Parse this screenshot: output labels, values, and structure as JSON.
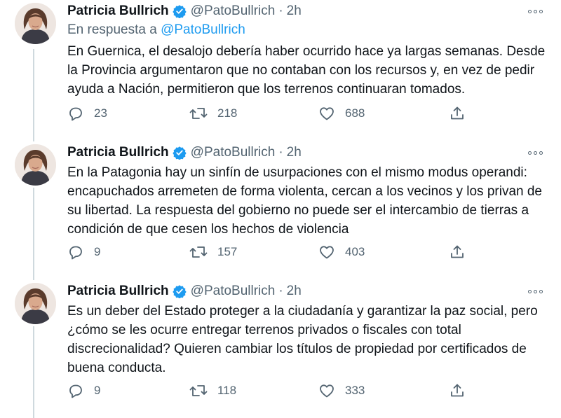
{
  "tweets": [
    {
      "author_name": "Patricia Bullrich",
      "handle": "@PatoBullrich",
      "separator": "·",
      "time": "2h",
      "reply_prefix": "En respuesta a",
      "reply_mention": "@PatoBullrich",
      "text": "En Guernica, el desalojo debería haber ocurrido hace ya largas semanas. Desde la Provincia argumentaron que no contaban con los recursos y, en vez de pedir ayuda a Nación, permitieron que los terrenos continuaran tomados.",
      "replies": "23",
      "retweets": "218",
      "likes": "688"
    },
    {
      "author_name": "Patricia Bullrich",
      "handle": "@PatoBullrich",
      "separator": "·",
      "time": "2h",
      "text": "En la Patagonia hay un sinfín de usurpaciones con el mismo modus operandi: encapuchados arremeten de forma violenta, cercan a los vecinos y los privan de su libertad. La respuesta del gobierno no puede ser el intercambio de tierras a condición de que cesen los hechos de violencia",
      "replies": "9",
      "retweets": "157",
      "likes": "403"
    },
    {
      "author_name": "Patricia Bullrich",
      "handle": "@PatoBullrich",
      "separator": "·",
      "time": "2h",
      "text": "Es un deber del Estado proteger a la ciudadanía y garantizar la paz social, pero ¿cómo se les ocurre entregar terrenos privados o fiscales con total discrecionalidad? Quieren cambiar los títulos de propiedad por certificados de buena conducta.",
      "replies": "9",
      "retweets": "118",
      "likes": "333"
    }
  ],
  "colors": {
    "accent": "#1d9bf0",
    "secondary_text": "#536471",
    "primary_text": "#0f1419",
    "thread_line": "#cfd9de"
  },
  "icons": [
    "verified-badge-icon",
    "more-icon",
    "reply-icon",
    "retweet-icon",
    "like-icon",
    "share-icon"
  ]
}
